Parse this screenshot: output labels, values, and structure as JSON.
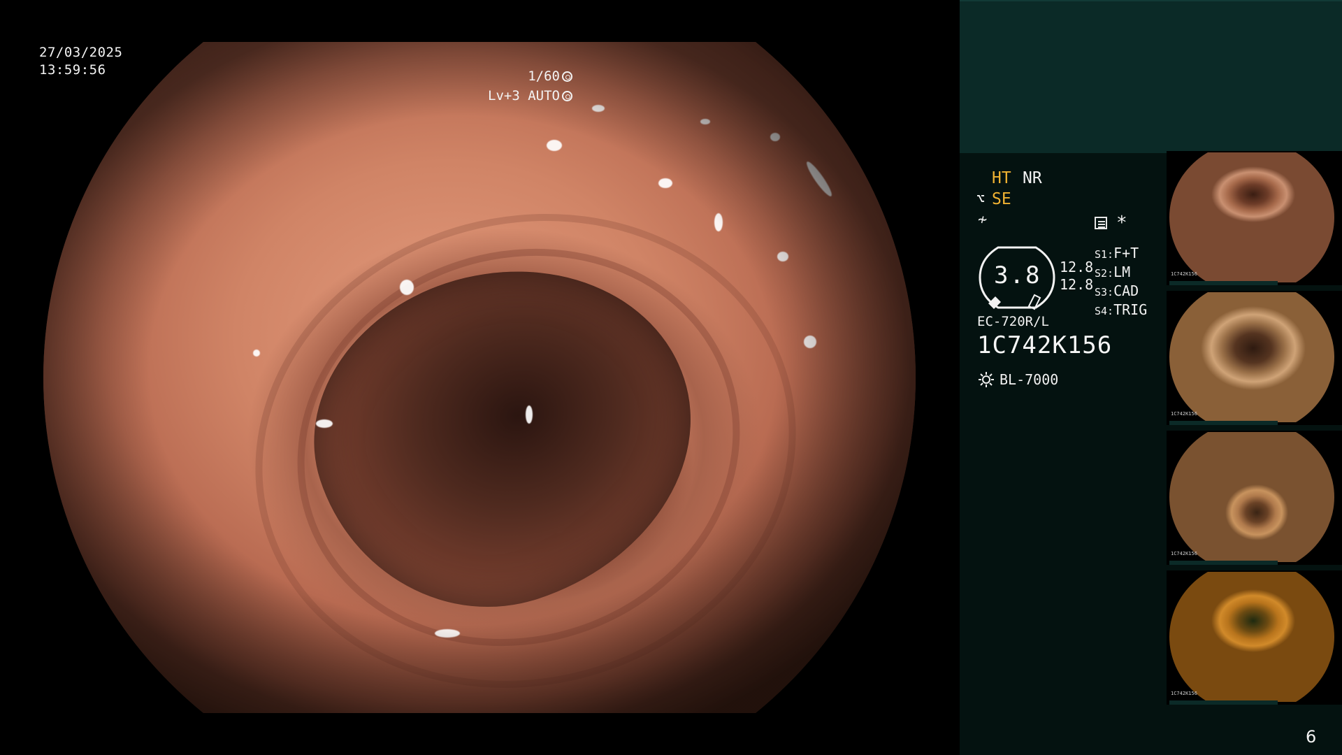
{
  "overlay": {
    "date": "27/03/2025",
    "time": "13:59:56",
    "shutter": "1/60",
    "level": "Lv+3 AUTO"
  },
  "status": {
    "ht": "HT",
    "nr": "NR",
    "se": "SE",
    "asterisk": "*"
  },
  "gauge": {
    "value": "3.8",
    "num_top": "12.8",
    "num_bottom": "12.8"
  },
  "s_list": [
    {
      "key": "S1:",
      "value": "F+T"
    },
    {
      "key": "S2:",
      "value": "LM"
    },
    {
      "key": "S3:",
      "value": "CAD"
    },
    {
      "key": "S4:",
      "value": "TRIG"
    }
  ],
  "scope": {
    "model": "EC-720R/L",
    "serial": "1C742K156",
    "light_source": "BL-7000"
  },
  "thumbnails": [
    {
      "caption": "1C742K156"
    },
    {
      "caption": "1C742K156"
    },
    {
      "caption": "1C742K156"
    },
    {
      "caption": "1C742K156"
    }
  ],
  "page_number": "6",
  "colors": {
    "panel_background": "#041210",
    "panel_header": "#0b2a27",
    "highlight_orange": "#f0b232",
    "text": "#f2f2f2"
  }
}
